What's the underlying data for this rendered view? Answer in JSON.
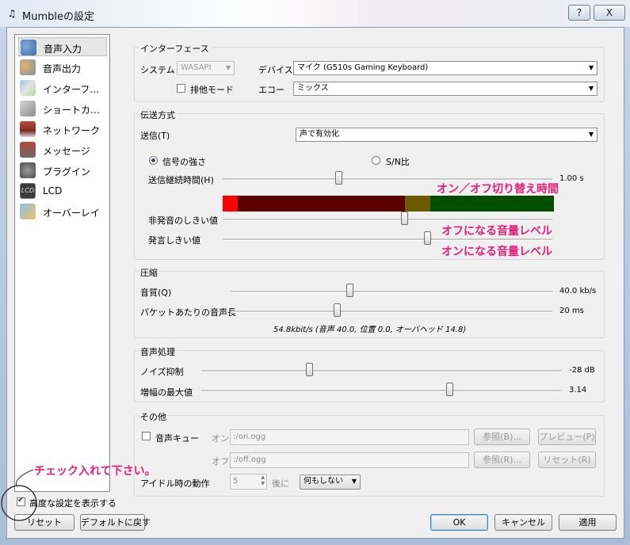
{
  "window": {
    "title": "Mumbleの設定",
    "help_label": "?",
    "close_label": "X"
  },
  "sidebar": {
    "items": [
      {
        "label": "音声入力",
        "icon": "microphone-user-icon",
        "selected": true
      },
      {
        "label": "音声出力",
        "icon": "speaker-user-icon",
        "selected": false
      },
      {
        "label": "インターフ…",
        "icon": "interface-icon",
        "selected": false
      },
      {
        "label": "ショートカ…",
        "icon": "shortcut-icon",
        "selected": false
      },
      {
        "label": "ネットワーク",
        "icon": "network-icon",
        "selected": false
      },
      {
        "label": "メッセージ",
        "icon": "message-icon",
        "selected": false
      },
      {
        "label": "プラグイン",
        "icon": "plugin-icon",
        "selected": false
      },
      {
        "label": "LCD",
        "icon": "lcd-icon",
        "selected": false
      },
      {
        "label": "オーバーレイ",
        "icon": "overlay-icon",
        "selected": false
      }
    ]
  },
  "interface": {
    "title": "インターフェース",
    "system_label": "システム",
    "system_value": "WASAPI",
    "device_label": "デバイス",
    "device_value": "マイク (G510s Gaming Keyboard)",
    "exclusive_label": "排他モード",
    "exclusive_checked": false,
    "echo_label": "エコー",
    "echo_value": "ミックス"
  },
  "transmission": {
    "title": "伝送方式",
    "send_label": "送信(T)",
    "send_value": "声で有効化",
    "signal_label": "信号の強さ",
    "signal_selected": true,
    "snr_label": "S/N比",
    "hold_label": "送信継続時間(H)",
    "hold_value": "1.00 s",
    "hold_level": 0.35,
    "silence_label": "非発音のしきい値",
    "silence_level": 0.55,
    "speech_label": "発言しきい値",
    "speech_level": 0.62,
    "vu_colors": {
      "peak": "#ff0000",
      "low": "#5a0000",
      "mid": "#6b5a00",
      "high": "#004f00"
    }
  },
  "compression": {
    "title": "圧縮",
    "quality_label": "音質(Q)",
    "quality_value": "40.0 kb/s",
    "quality_level": 0.37,
    "frames_label": "パケットあたりの音声長",
    "frames_value": "20 ms",
    "frames_level": 0.33,
    "summary": "54.8kbit/s (音声 40.0, 位置 0.0, オーバヘッド 14.8)"
  },
  "processing": {
    "title": "音声処理",
    "noise_label": "ノイズ抑制",
    "noise_value": "-28 dB",
    "noise_level": 0.3,
    "amp_label": "増幅の最大値",
    "amp_value": "3.14",
    "amp_level": 0.69
  },
  "misc": {
    "title": "その他",
    "cue_label": "音声キュー",
    "cue_checked": false,
    "on_label": "オン",
    "on_path": ":/on.ogg",
    "off_label": "オフ",
    "off_path": ":/off.ogg",
    "browse_on_label": "参照(B)...",
    "preview_label": "プレビュー(P)",
    "browse_off_label": "参照(R)...",
    "reset_label": "リセット(R)",
    "idle_label": "アイドル時の動作",
    "idle_value": "5",
    "after_label": "後に",
    "action_value": "何もしない"
  },
  "footer": {
    "advanced_label": "高度な設定を表示する",
    "advanced_checked": true,
    "reset_label": "リセット",
    "defaults_label": "デフォルトに戻す",
    "ok_label": "OK",
    "cancel_label": "キャンセル",
    "apply_label": "適用"
  },
  "annotations": {
    "toggle_time": "オン／オフ切り替え時間",
    "off_level": "オフになる音量レベル",
    "on_level": "オンになる音量レベル",
    "check_note": "チェック入れて下さい。",
    "color": "#e6207a"
  }
}
